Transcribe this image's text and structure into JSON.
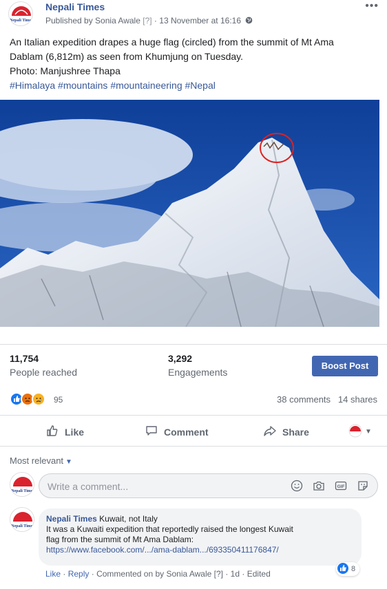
{
  "post": {
    "page_name": "Nepali Times",
    "published_by": "Published by Sonia Awale",
    "qmark": "[?]",
    "date": "13 November at 16:16",
    "text_line1": "An Italian expedition drapes a huge flag (circled) from the summit of Mt Ama",
    "text_line2": "Dablam (6,812m) as seen from Khumjung on Tuesday.",
    "photo_credit": "Photo: Manjushree Thapa",
    "hashtags": [
      "#Himalaya",
      "#mountains",
      "#mountaineering",
      "#Nepal"
    ],
    "avatar_text": "Nepali Times"
  },
  "stats": {
    "reached_value": "11,754",
    "reached_label": "People reached",
    "engagements_value": "3,292",
    "engagements_label": "Engagements",
    "boost_label": "Boost Post"
  },
  "reactions": {
    "count": "95",
    "comments": "38 comments",
    "shares": "14 shares"
  },
  "actions": {
    "like": "Like",
    "comment": "Comment",
    "share": "Share"
  },
  "comments_section": {
    "sort_label": "Most relevant",
    "input_placeholder": "Write a comment..."
  },
  "comment": {
    "author": "Nepali Times",
    "first_line": "Kuwait, not Italy",
    "body_line1": "It was a Kuwaiti expedition that reportedly raised the longest Kuwait",
    "body_line2": "flag from the summit of Mt Ama Dablam:",
    "link": "https://www.facebook.com/.../ama-dablam.../693350411176847/",
    "like": "Like",
    "reply": "Reply",
    "commented_on": "Commented on by Sonia Awale",
    "qmark": "[?]",
    "age": "1d",
    "edited": "Edited",
    "reaction_count": "8"
  },
  "colors": {
    "fb_blue": "#4267b2",
    "link_blue": "#385898",
    "sky": "#1a4fa8"
  }
}
